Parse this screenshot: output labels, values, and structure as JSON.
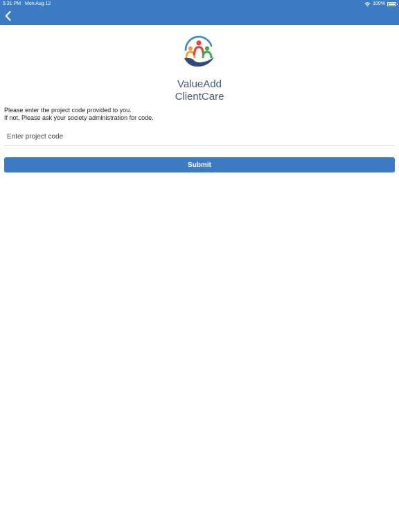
{
  "status_bar": {
    "time": "5:31 PM",
    "date": "Mon Aug 12",
    "battery": "100%"
  },
  "header": {
    "back_icon": "chevron-left-icon"
  },
  "app": {
    "logo_icon": "people-in-hand-logo",
    "name_line1": "ValueAdd",
    "name_line2": "ClientCare"
  },
  "form": {
    "instruction_line1": "Please enter the project code provided to you.",
    "instruction_line2": "If not, Please ask your society administration for code.",
    "code_value": "",
    "code_placeholder": "Enter project code",
    "submit_label": "Submit"
  },
  "colors": {
    "accent": "#3d7bc4",
    "title_text": "#44597a",
    "logo_orange": "#f2a33a",
    "logo_red": "#e2473b",
    "logo_green": "#3fae49",
    "logo_navy": "#2f4a77",
    "logo_blue": "#3e86c7"
  }
}
